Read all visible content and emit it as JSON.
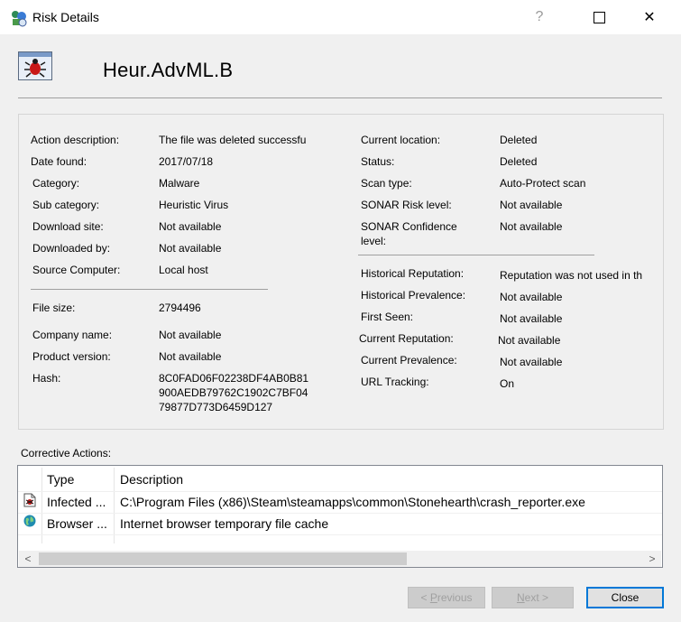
{
  "window": {
    "title": "Risk Details",
    "help_glyph": "?",
    "max_glyph": "",
    "close_glyph": "✕"
  },
  "header": {
    "risk_name": "Heur.AdvML.B"
  },
  "details_left": [
    {
      "label": "Action description:",
      "value": "The file was deleted successfu"
    },
    {
      "label": "Date found:",
      "value": "2017/07/18"
    },
    {
      "label": "Category:",
      "value": "Malware"
    },
    {
      "label": "Sub category:",
      "value": "Heuristic Virus"
    },
    {
      "label": "Download site:",
      "value": "Not available"
    },
    {
      "label": "Downloaded by:",
      "value": "Not available"
    },
    {
      "label": "Source Computer:",
      "value": "Local host"
    },
    {
      "label": "File size:",
      "value": "2794496"
    },
    {
      "label": "Company name:",
      "value": "Not available"
    },
    {
      "label": "Product version:",
      "value": "Not available"
    },
    {
      "label": "Hash:",
      "value_lines": [
        "8C0FAD06F02238DF4AB0B81",
        "900AEDB79762C1902C7BF04",
        "79877D773D6459D127"
      ]
    }
  ],
  "details_right": [
    {
      "label": "Current location:",
      "value": "Deleted"
    },
    {
      "label": "Status:",
      "value": "Deleted"
    },
    {
      "label": "Scan type:",
      "value": "Auto-Protect scan"
    },
    {
      "label": "SONAR Risk level:",
      "value": "Not available"
    },
    {
      "label_lines": [
        "SONAR Confidence",
        "level:"
      ],
      "value": "Not available"
    },
    {
      "label": "Historical Reputation:",
      "value": "Reputation was not used in th"
    },
    {
      "label": "Historical Prevalence:",
      "value": "Not available"
    },
    {
      "label": "First Seen:",
      "value": "Not available"
    },
    {
      "label": "Current Reputation:",
      "value": "Not available"
    },
    {
      "label": "Current Prevalence:",
      "value": "Not available"
    },
    {
      "label": "URL Tracking:",
      "value": "On"
    }
  ],
  "corrective": {
    "label": "Corrective Actions:",
    "columns": [
      "Type",
      "Description"
    ],
    "rows": [
      {
        "icon": "infected-file-icon",
        "type": "Infected ...",
        "description": "C:\\Program Files (x86)\\Steam\\steamapps\\common\\Stonehearth\\crash_reporter.exe"
      },
      {
        "icon": "browser-globe-icon",
        "type": "Browser ...",
        "description": "Internet browser temporary file cache"
      }
    ],
    "scroll_left_glyph": "<",
    "scroll_right_glyph": ">"
  },
  "buttons": {
    "previous": {
      "prefix": "< ",
      "accel": "P",
      "rest": "revious"
    },
    "next": {
      "accel": "N",
      "rest": "ext >"
    },
    "close": "Close"
  },
  "colors": {
    "accent": "#0078d7",
    "background": "#f0f0f0"
  }
}
